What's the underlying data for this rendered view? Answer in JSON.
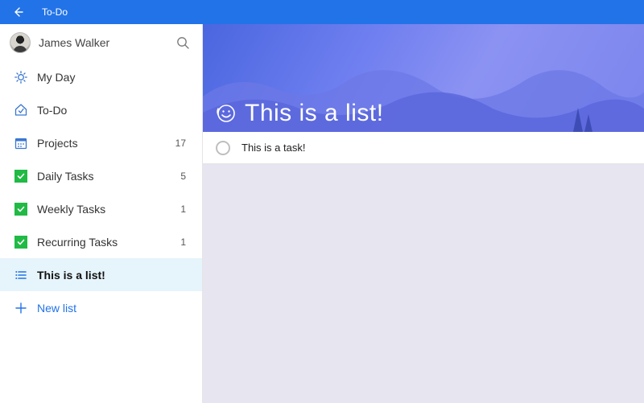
{
  "titlebar": {
    "app_name": "To-Do"
  },
  "profile": {
    "name": "James Walker"
  },
  "sidebar": {
    "items": [
      {
        "label": "My Day",
        "count": "",
        "icon": "sun"
      },
      {
        "label": "To-Do",
        "count": "",
        "icon": "home-check"
      },
      {
        "label": "Projects",
        "count": "17",
        "icon": "calendar"
      },
      {
        "label": "Daily Tasks",
        "count": "5",
        "icon": "green-check"
      },
      {
        "label": "Weekly Tasks",
        "count": "1",
        "icon": "green-check"
      },
      {
        "label": "Recurring Tasks",
        "count": "1",
        "icon": "green-check"
      },
      {
        "label": "This is a list!",
        "count": "",
        "icon": "list"
      }
    ],
    "new_list_label": "New list"
  },
  "hero": {
    "title": "This is a list!"
  },
  "tasks": [
    {
      "title": "This is a task!"
    }
  ]
}
